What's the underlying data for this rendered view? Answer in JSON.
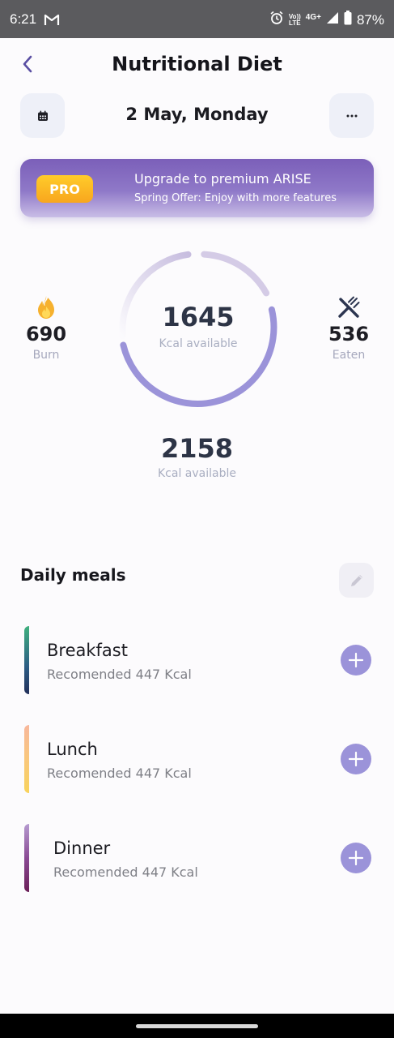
{
  "status_bar": {
    "time": "6:21",
    "network_top": "Vo))",
    "network_bottom": "LTE",
    "network_gen": "4G+",
    "battery": "87%"
  },
  "header": {
    "title": "Nutritional Diet"
  },
  "date_row": {
    "date": "2 May, Monday"
  },
  "promo": {
    "badge": "PRO",
    "title": "Upgrade to premium ARISE",
    "subtitle": "Spring Offer: Enjoy with more features"
  },
  "summary": {
    "burn": {
      "value": "690",
      "label": "Burn"
    },
    "eaten": {
      "value": "536",
      "label": "Eaten"
    },
    "available": {
      "value": "1645",
      "label": "Kcal available"
    },
    "total": {
      "value": "2158",
      "label": "Kcal available"
    }
  },
  "meals_section": {
    "title": "Daily meals",
    "meals": [
      {
        "name": "Breakfast",
        "recommended": "Recomended 447 Kcal"
      },
      {
        "name": "Lunch",
        "recommended": "Recomended 447 Kcal"
      },
      {
        "name": "Dinner",
        "recommended": "Recomended 447 Kcal"
      }
    ]
  },
  "colors": {
    "accent": "#9b93d9",
    "promo": "#7b5fb9",
    "pro_badge": "#f8a61e"
  },
  "icons": {
    "back": "chevron-left-icon",
    "calendar": "calendar-icon",
    "more": "more-horizontal-icon",
    "burn": "flame-icon",
    "eaten": "fork-knife-icon",
    "edit": "pencil-icon",
    "add": "plus-icon"
  }
}
